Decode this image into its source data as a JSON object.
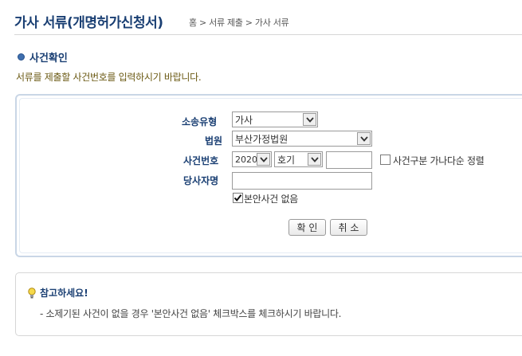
{
  "header": {
    "title": "가사 서류(개명허가신청서)",
    "breadcrumb": "홈 > 서류 제출 > 가사 서류"
  },
  "section": {
    "title": "사건확인",
    "instruction": "서류를 제출할 사건번호를 입력하시기 바랍니다."
  },
  "form": {
    "case_type": {
      "label": "소송유형",
      "value": "가사"
    },
    "court": {
      "label": "법원",
      "value": "부산가정법원"
    },
    "case_number": {
      "label": "사건번호",
      "year": "2020",
      "code": "호기",
      "number_value": "",
      "sort_checkbox_label": "사건구분 가나다순 정렬",
      "sort_checked": false
    },
    "party_name": {
      "label": "당사자명",
      "value": "",
      "no_party_checkbox_label": "본안사건 없음",
      "no_party_checked": true
    },
    "confirm_button": "확 인",
    "cancel_button": "취 소"
  },
  "note": {
    "title": "참고하세요!",
    "text": "- 소제기된 사건이 없을 경우 '본안사건 없음' 체크박스를 체크하시기 바랍니다."
  },
  "colors": {
    "title": "#1a3f73",
    "instruction": "#6b5a14",
    "border": "#c9d6e6"
  }
}
